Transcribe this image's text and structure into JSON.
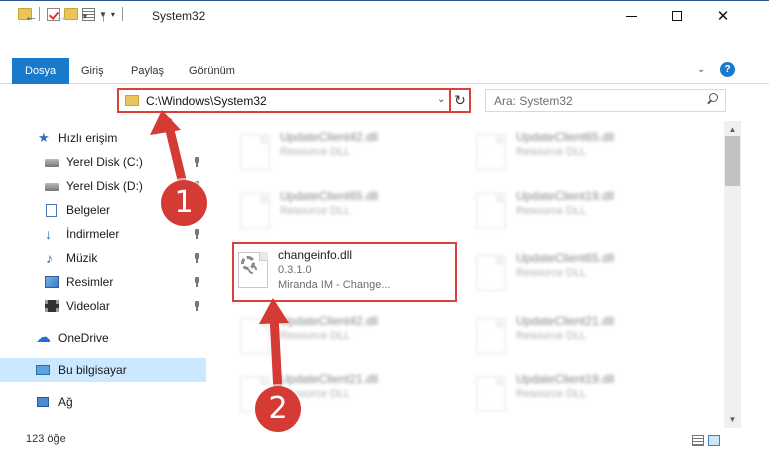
{
  "window": {
    "title": "System32"
  },
  "ribbon": {
    "tabs": [
      {
        "label": "Dosya"
      },
      {
        "label": "Giriş"
      },
      {
        "label": "Paylaş"
      },
      {
        "label": "Görünüm"
      }
    ],
    "help": "?"
  },
  "navigation": {
    "address": "C:\\Windows\\System32",
    "search_placeholder": "Ara: System32"
  },
  "sidebar": {
    "items": [
      {
        "label": "Hızlı erişim",
        "icon": "star-icon"
      },
      {
        "label": "Yerel Disk (C:)",
        "icon": "drive-icon",
        "pinned": true
      },
      {
        "label": "Yerel Disk (D:)",
        "icon": "drive-icon",
        "pinned": true
      },
      {
        "label": "Belgeler",
        "icon": "documents-icon",
        "pinned": true
      },
      {
        "label": "İndirmeler",
        "icon": "downloads-icon",
        "pinned": true
      },
      {
        "label": "Müzik",
        "icon": "music-icon",
        "pinned": true
      },
      {
        "label": "Resimler",
        "icon": "pictures-icon",
        "pinned": true
      },
      {
        "label": "Videolar",
        "icon": "videos-icon",
        "pinned": true
      },
      {
        "label": "OneDrive",
        "icon": "onedrive-icon"
      },
      {
        "label": "Bu bilgisayar",
        "icon": "computer-icon",
        "selected": true
      },
      {
        "label": "Ağ",
        "icon": "network-icon"
      }
    ]
  },
  "files": [
    {
      "name": "UpdateClient42.dll",
      "desc": "Resource DLL",
      "blurred": true
    },
    {
      "name": "UpdateClient65.dll",
      "desc": "Resource DLL",
      "blurred": true
    },
    {
      "name": "UpdateClient65.dll",
      "desc": "Resource DLL",
      "blurred": true
    },
    {
      "name": "UpdateClient19.dll",
      "desc": "Resource DLL",
      "blurred": true
    },
    {
      "name": "changeinfo.dll",
      "version": "0.3.1.0",
      "desc": "Miranda IM - Change...",
      "blurred": false,
      "highlighted": true
    },
    {
      "name": "UpdateClient65.dll",
      "desc": "Resource DLL",
      "blurred": true
    },
    {
      "name": "UpdateClient42.dll",
      "desc": "Resource DLL",
      "blurred": true
    },
    {
      "name": "UpdateClient21.dll",
      "desc": "Resource DLL",
      "blurred": true
    },
    {
      "name": "UpdateClient21.dll",
      "desc": "Resource DLL",
      "blurred": true
    },
    {
      "name": "UpdateClient19.dll",
      "desc": "Resource DLL",
      "blurred": true
    }
  ],
  "status": {
    "count": "123 öğe"
  },
  "annotations": {
    "marker1": "1",
    "marker2": "2"
  },
  "colors": {
    "accent": "#1979ca",
    "highlight": "#d9413a",
    "selected": "#cce8ff"
  }
}
